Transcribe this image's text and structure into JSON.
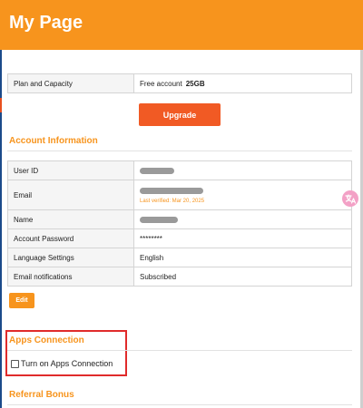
{
  "header": {
    "title": "My Page"
  },
  "plan": {
    "label": "Plan and Capacity",
    "value": "Free account",
    "capacity": "25GB",
    "upgrade_label": "Upgrade"
  },
  "account_information": {
    "title": "Account Information",
    "rows": {
      "user_id": {
        "label": "User ID"
      },
      "email": {
        "label": "Email",
        "verified_note": "Last verified: Mar 20, 2025"
      },
      "name": {
        "label": "Name"
      },
      "password": {
        "label": "Account Password",
        "value": "********"
      },
      "language": {
        "label": "Language Settings",
        "value": "English"
      },
      "notifications": {
        "label": "Email notifications",
        "value": "Subscribed"
      }
    },
    "edit_label": "Edit"
  },
  "apps_connection": {
    "title": "Apps Connection",
    "checkbox_label": "Turn on Apps Connection",
    "checked": false
  },
  "referral_bonus": {
    "title": "Referral Bonus"
  },
  "colors": {
    "header": "#f7941d",
    "upgrade_button": "#f15a24",
    "highlight_border": "#e02b2b"
  },
  "icons": {
    "translate": "translate-icon"
  }
}
